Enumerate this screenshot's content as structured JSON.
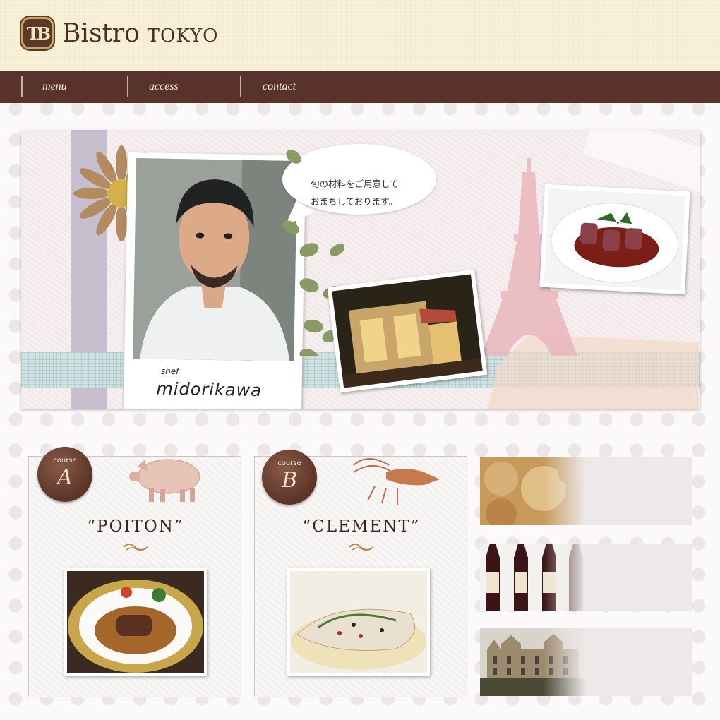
{
  "header": {
    "logo_monogram": "TB",
    "logo_bistro": "Bistro",
    "logo_tokyo": "TOKYO"
  },
  "nav": {
    "items": [
      {
        "label": "menu"
      },
      {
        "label": "access"
      },
      {
        "label": "contact"
      }
    ]
  },
  "hero": {
    "bubble_line1": "旬の材料をご用意して",
    "bubble_line2": "おまちしております。",
    "caption_small": "shef",
    "caption_name": "midorikawa"
  },
  "courses": [
    {
      "badge": "course",
      "letter": "A",
      "title": "“POITON”"
    },
    {
      "badge": "course",
      "letter": "B",
      "title": "“CLEMENT”"
    }
  ],
  "colors": {
    "nav_bg": "#59332b",
    "brand_brown": "#4a2e20",
    "seal": "#6b3f30"
  }
}
